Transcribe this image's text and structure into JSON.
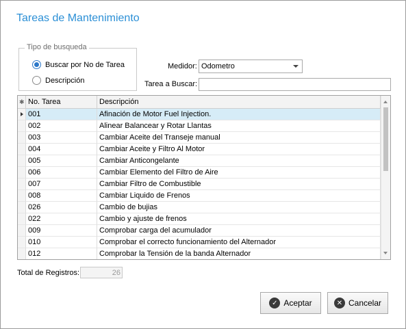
{
  "dialog": {
    "title": "Tareas de Mantenimiento"
  },
  "search_type": {
    "legend": "Tipo de busqueda",
    "options": [
      {
        "label": "Buscar por No de Tarea",
        "checked": true
      },
      {
        "label": "Descripción",
        "checked": false
      }
    ]
  },
  "medidor": {
    "label": "Medidor:",
    "value": "Odometro"
  },
  "tarea_buscar": {
    "label": "Tarea a Buscar:",
    "value": ""
  },
  "grid": {
    "columns": [
      "No. Tarea",
      "Descripción"
    ],
    "header_icon": "asterisk-icon",
    "selected_index": 0,
    "rows": [
      {
        "code": "001",
        "desc": "Afinación de Motor Fuel Injection."
      },
      {
        "code": "002",
        "desc": "Alinear Balancear y Rotar Llantas"
      },
      {
        "code": "003",
        "desc": "Cambiar Aceite del Transeje manual"
      },
      {
        "code": "004",
        "desc": "Cambiar Aceite y Filtro Al Motor"
      },
      {
        "code": "005",
        "desc": "Cambiar Anticongelante"
      },
      {
        "code": "006",
        "desc": "Cambiar Elemento del Filtro de Aire"
      },
      {
        "code": "007",
        "desc": "Cambiar Filtro de Combustible"
      },
      {
        "code": "008",
        "desc": "Cambiar Liquido de Frenos"
      },
      {
        "code": "026",
        "desc": "Cambio de bujias"
      },
      {
        "code": "022",
        "desc": "Cambio y ajuste de frenos"
      },
      {
        "code": "009",
        "desc": "Comprobar carga del acumulador"
      },
      {
        "code": "010",
        "desc": "Comprobar el correcto funcionamiento del Alternador"
      },
      {
        "code": "012",
        "desc": "Comprobar la Tensión de la banda Alternador"
      }
    ]
  },
  "total": {
    "label": "Total de Registros:",
    "value": "26"
  },
  "buttons": {
    "accept": {
      "label": "Aceptar",
      "icon": "check-circle-icon"
    },
    "cancel": {
      "label": "Cancelar",
      "icon": "close-circle-icon"
    }
  },
  "colors": {
    "title": "#2b8fd6",
    "selected_row": "#d6ecf7",
    "radio_accent": "#2b78c9"
  }
}
